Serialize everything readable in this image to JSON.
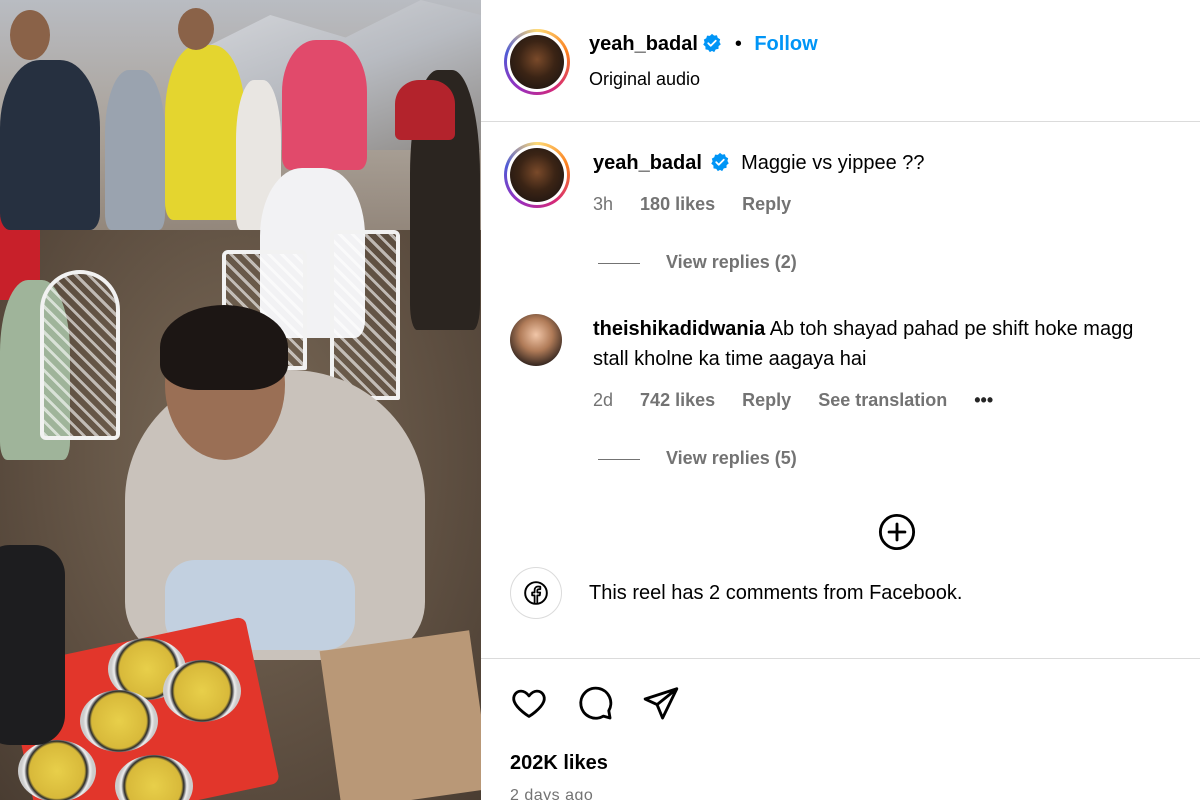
{
  "header": {
    "username": "yeah_badal",
    "follow_label": "Follow",
    "separator": "•",
    "audio": "Original audio"
  },
  "comments": [
    {
      "username": "yeah_badal",
      "text": "Maggie vs yippee ??",
      "time": "3h",
      "likes": "180 likes",
      "reply_label": "Reply",
      "view_replies": "View replies (2)"
    },
    {
      "username": "theishikadidwania",
      "text_line1": "Ab toh shayad pahad pe shift hoke magg",
      "text_line2": "stall kholne ka time aagaya hai",
      "time": "2d",
      "likes": "742 likes",
      "reply_label": "Reply",
      "translation_label": "See translation",
      "more": "•••",
      "view_replies": "View replies (5)"
    }
  ],
  "facebook_notice": "This reel has 2 comments from Facebook.",
  "footer": {
    "likes": "202K likes",
    "time_ago": "2 days ago"
  },
  "icons": {
    "verified": "verified-badge-icon",
    "add": "plus-circle-icon",
    "facebook": "facebook-icon",
    "like": "heart-icon",
    "comment": "comment-icon",
    "share": "send-icon"
  },
  "colors": {
    "accent": "#0095f6",
    "muted": "#737373",
    "divider": "#dbdbdb"
  }
}
